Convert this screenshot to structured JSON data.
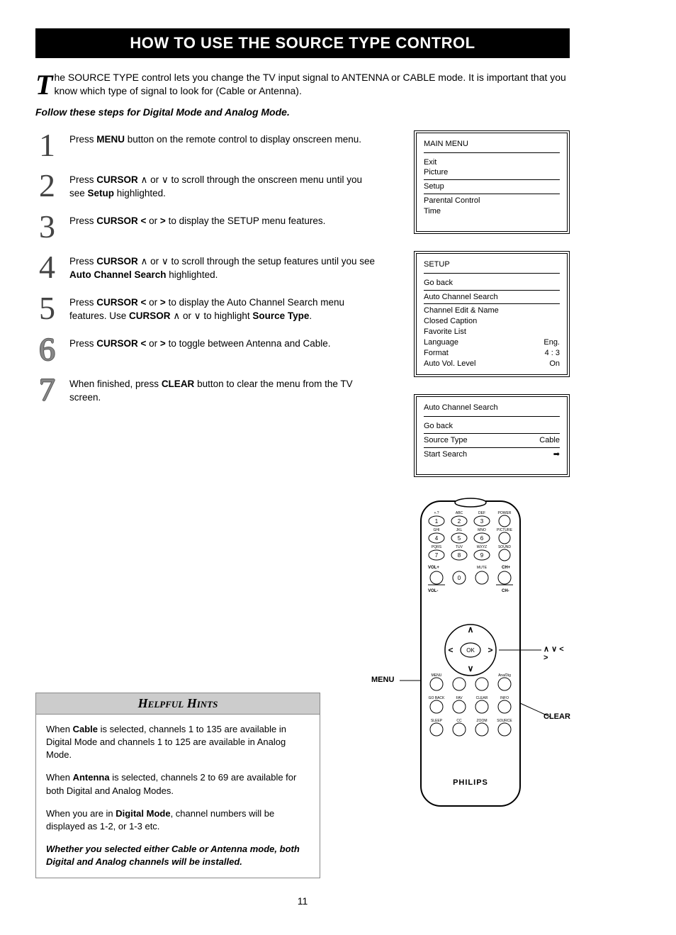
{
  "title": "HOW TO USE THE SOURCE TYPE CONTROL",
  "intro_dropcap": "T",
  "intro_rest": "he SOURCE TYPE control lets you change the TV input signal to ANTENNA or CABLE mode. It is important that you know which type of signal to look for (Cable or Antenna).",
  "sub_intro": "Follow these steps for Digital Mode and Analog Mode.",
  "steps": [
    {
      "num": "1",
      "html": "Press <b>MENU</b> button on the remote control to display onscreen menu."
    },
    {
      "num": "2",
      "html": "Press <b>CURSOR</b> ∧ or ∨ to scroll through the onscreen menu until you see <b>Setup</b> highlighted."
    },
    {
      "num": "3",
      "html": "Press <b>CURSOR &lt;</b> or <b>&gt;</b> to display the SETUP menu features."
    },
    {
      "num": "4",
      "html": "Press <b>CURSOR</b> ∧ or ∨ to scroll through the setup features until you see <b>Auto Channel Search</b> highlighted."
    },
    {
      "num": "5",
      "html": "Press <b>CURSOR &lt;</b> or <b>&gt;</b> to display the Auto Channel Search menu features. Use <b>CURSOR</b> ∧ or ∨ to highlight <b>Source Type</b>."
    },
    {
      "num": "6",
      "html": "Press <b>CURSOR &lt;</b> or <b>&gt;</b> to toggle between Antenna and Cable."
    },
    {
      "num": "7",
      "html": "When finished, press <b>CLEAR</b> button to clear the menu from the TV screen."
    }
  ],
  "osd1": {
    "title": "MAIN MENU",
    "items": [
      "Exit",
      "Picture",
      "Setup",
      "Parental Control",
      "Time"
    ]
  },
  "osd2": {
    "title": "SETUP",
    "rows": [
      [
        "Go back",
        ""
      ],
      [
        "Auto Channel Search",
        ""
      ],
      [
        "Channel Edit & Name",
        ""
      ],
      [
        "Closed Caption",
        ""
      ],
      [
        "Favorite List",
        ""
      ],
      [
        "Language",
        "Eng."
      ],
      [
        "Format",
        "4 : 3"
      ],
      [
        "Auto Vol. Level",
        "On"
      ]
    ]
  },
  "osd3": {
    "title": "Auto Channel Search",
    "rows": [
      [
        "Go back",
        ""
      ],
      [
        "Source Type",
        "Cable"
      ],
      [
        "Start Search",
        "➡"
      ]
    ]
  },
  "hints": {
    "header": "Helpful Hints",
    "p1": "When <b>Cable</b> is selected, channels 1 to 135 are available in Digital Mode and channels 1 to 125 are available in Analog Mode.",
    "p2": "When <b>Antenna</b> is selected, channels 2 to 69 are available for both Digital and Analog Modes.",
    "p3": "When you are in <b>Digital Mode</b>, channel numbers will be displayed as 1-2, or 1-3 etc.",
    "p4": "<b><i>Whether you selected either Cable or Antenna mode, both Digital and Analog channels will be installed.</i></b>"
  },
  "remote": {
    "brand": "PHILIPS",
    "label_menu": "MENU",
    "label_clear": "CLEAR",
    "label_cursor": "∧  ∨  <  >",
    "keypad_labels": {
      "row1": [
        "+.?",
        "ABC",
        "DEF",
        "POWER"
      ],
      "row2": [
        "GHI",
        "JKL",
        "MNO",
        "PICTURE"
      ],
      "row3": [
        "PQRS",
        "TUV",
        "WXYZ",
        "SOUND"
      ],
      "row4_left": "VOL+",
      "row4_right": "CH+",
      "row5_left": "VOL-",
      "row5_right": "CH-",
      "mute": "MUTE",
      "nums": [
        "1",
        "2",
        "3",
        "4",
        "5",
        "6",
        "7",
        "8",
        "9",
        "0"
      ]
    },
    "row_menu": [
      "MENU",
      "",
      "",
      "Ana/Dig"
    ],
    "row_back": [
      "GO BACK",
      "FAV",
      "CLEAR",
      "INFO"
    ],
    "row_sleep": [
      "SLEEP",
      "CC",
      "ZOOM",
      "SOURCE"
    ]
  },
  "page_number": "11"
}
